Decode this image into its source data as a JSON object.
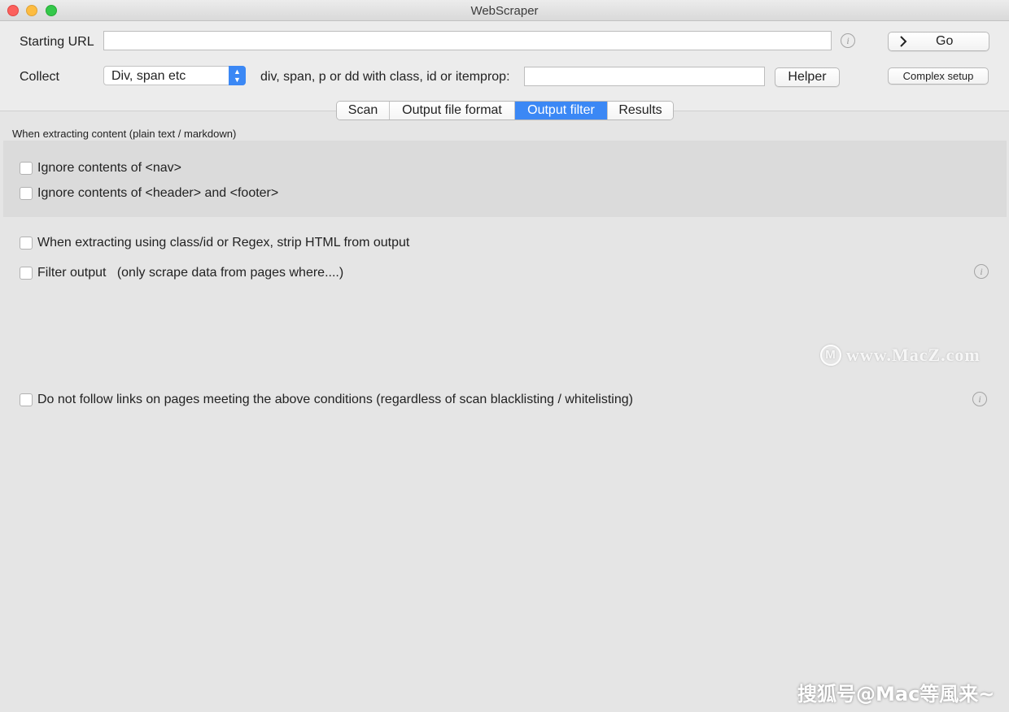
{
  "window": {
    "title": "WebScraper"
  },
  "starting_url": {
    "label": "Starting URL",
    "value": "",
    "info_icon": "info-icon"
  },
  "go_button": {
    "label": "Go",
    "icon": "chevron-right-icon"
  },
  "collect": {
    "label": "Collect",
    "selected": "Div, span etc",
    "description": "div, span, p or dd with class, id or itemprop:",
    "value": ""
  },
  "helper_button": {
    "label": "Helper"
  },
  "complex_setup_button": {
    "label": "Complex setup"
  },
  "tabs": [
    {
      "label": "Scan",
      "active": false
    },
    {
      "label": "Output file format",
      "active": false
    },
    {
      "label": "Output filter",
      "active": true
    },
    {
      "label": "Results",
      "active": false
    }
  ],
  "output_filter": {
    "section_heading": "When extracting content (plain text / markdown)",
    "ignore_nav": {
      "label": "Ignore contents of <nav>",
      "checked": false
    },
    "ignore_header_footer": {
      "label": "Ignore contents of <header> and <footer>",
      "checked": false
    },
    "strip_html": {
      "label": "When extracting using class/id or Regex, strip HTML from output",
      "checked": false
    },
    "filter_output": {
      "label": "Filter output   (only scrape data from pages where....)",
      "checked": false
    },
    "do_not_follow": {
      "label": "Do not follow links on pages meeting the above conditions (regardless of scan blacklisting / whitelisting)",
      "checked": false
    }
  },
  "watermarks": {
    "macz": "www.MacZ.com",
    "macz_logo": "M",
    "sohu": "搜狐号@Mac等風来~"
  },
  "colors": {
    "accent": "#3b88f5",
    "window_bg": "#e5e5e5",
    "group_bg": "#dbdbdb"
  }
}
